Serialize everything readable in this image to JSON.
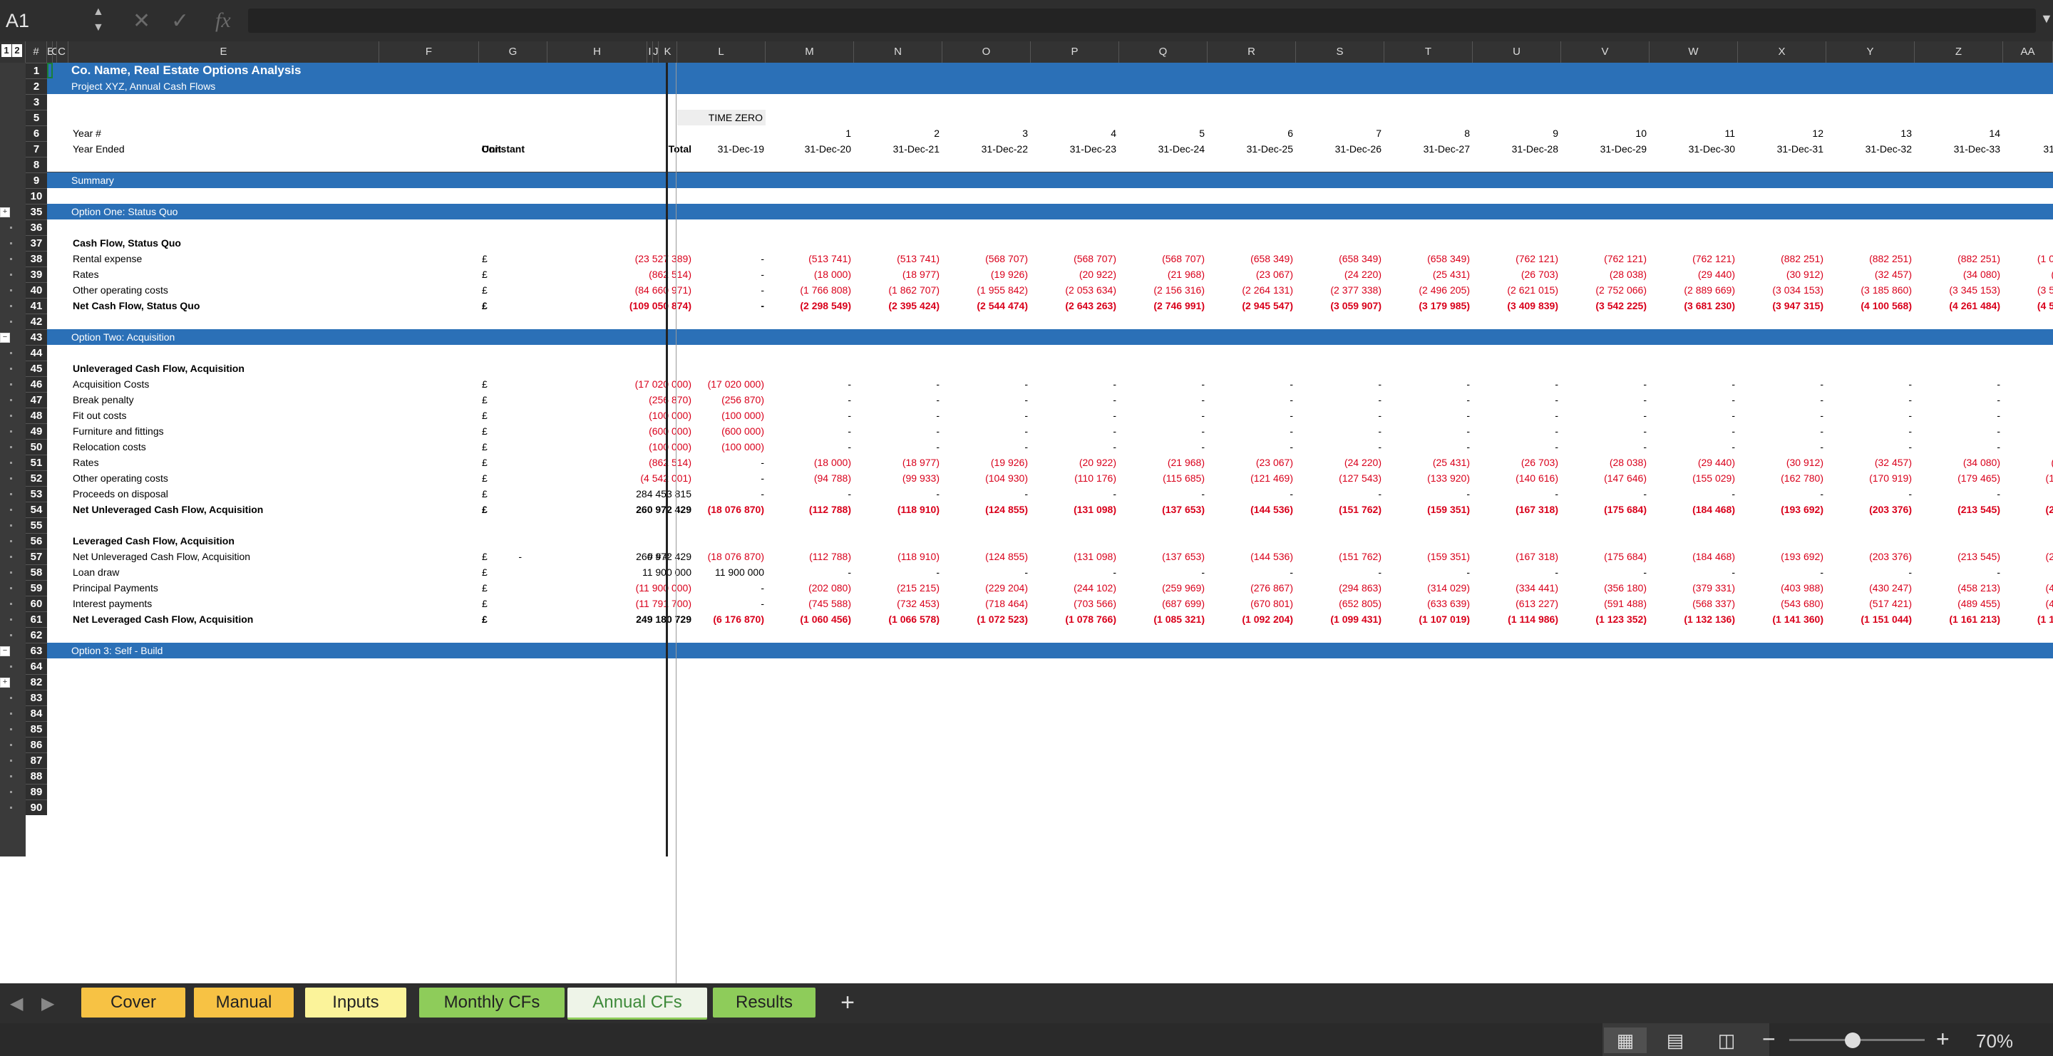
{
  "formula_bar": {
    "name_box": "A1",
    "fx_label": "fx",
    "formula": ""
  },
  "columns": [
    "",
    "#",
    "E",
    "C",
    "C",
    "E",
    "F",
    "G",
    "H",
    "I",
    "J",
    "K",
    "L",
    "M",
    "N",
    "O",
    "P",
    "Q",
    "R",
    "S",
    "T",
    "U",
    "V",
    "W",
    "X",
    "Y",
    "Z",
    "AA"
  ],
  "outline_levels": [
    "1",
    "2"
  ],
  "rows": [
    {
      "n": "1",
      "type": "band",
      "title": "Co. Name, Real Estate Options Analysis",
      "big": true
    },
    {
      "n": "2",
      "type": "band",
      "title": "Project XYZ, Annual Cash Flows"
    },
    {
      "n": "3",
      "type": "blank"
    },
    {
      "n": "5",
      "type": "timezero",
      "label": "TIME ZERO",
      "value": "-"
    },
    {
      "n": "6",
      "type": "header",
      "label": "Year #",
      "values": [
        "1",
        "2",
        "3",
        "4",
        "5",
        "6",
        "7",
        "8",
        "9",
        "10",
        "11",
        "12",
        "13",
        "14"
      ]
    },
    {
      "n": "7",
      "type": "header2",
      "label": "Year Ended",
      "constant": "Constant",
      "unit": "Unit",
      "total": "Total",
      "l": "31-Dec-19",
      "values": [
        "31-Dec-20",
        "31-Dec-21",
        "31-Dec-22",
        "31-Dec-23",
        "31-Dec-24",
        "31-Dec-25",
        "31-Dec-26",
        "31-Dec-27",
        "31-Dec-28",
        "31-Dec-29",
        "31-Dec-30",
        "31-Dec-31",
        "31-Dec-32",
        "31-Dec-33",
        "31"
      ]
    },
    {
      "n": "8",
      "type": "blank"
    },
    {
      "n": "9",
      "type": "band",
      "title": "Summary"
    },
    {
      "n": "10",
      "type": "blank"
    },
    {
      "n": "35",
      "type": "band",
      "title": "Option One: Status Quo"
    },
    {
      "n": "36",
      "type": "blank"
    },
    {
      "n": "37",
      "type": "section",
      "label": "Cash Flow, Status Quo"
    },
    {
      "n": "38",
      "type": "data",
      "label": "Rental expense",
      "unit": "£",
      "total": "(23 527 389)",
      "l": "-",
      "values": [
        "(513 741)",
        "(513 741)",
        "(568 707)",
        "(568 707)",
        "(568 707)",
        "(658 349)",
        "(658 349)",
        "(658 349)",
        "(762 121)",
        "(762 121)",
        "(762 121)",
        "(882 251)",
        "(882 251)",
        "(882 251)",
        "(1 0"
      ]
    },
    {
      "n": "39",
      "type": "data",
      "label": "Rates",
      "unit": "£",
      "total": "(862 514)",
      "l": "-",
      "values": [
        "(18 000)",
        "(18 977)",
        "(19 926)",
        "(20 922)",
        "(21 968)",
        "(23 067)",
        "(24 220)",
        "(25 431)",
        "(26 703)",
        "(28 038)",
        "(29 440)",
        "(30 912)",
        "(32 457)",
        "(34 080)",
        "("
      ]
    },
    {
      "n": "40",
      "type": "data",
      "label": "Other operating costs",
      "unit": "£",
      "total": "(84 660 971)",
      "l": "-",
      "values": [
        "(1 766 808)",
        "(1 862 707)",
        "(1 955 842)",
        "(2 053 634)",
        "(2 156 316)",
        "(2 264 131)",
        "(2 377 338)",
        "(2 496 205)",
        "(2 621 015)",
        "(2 752 066)",
        "(2 889 669)",
        "(3 034 153)",
        "(3 185 860)",
        "(3 345 153)",
        "(3 5"
      ]
    },
    {
      "n": "41",
      "type": "data",
      "bold": true,
      "label": "Net Cash Flow, Status Quo",
      "unit": "£",
      "total": "(109 050 874)",
      "l": "-",
      "values": [
        "(2 298 549)",
        "(2 395 424)",
        "(2 544 474)",
        "(2 643 263)",
        "(2 746 991)",
        "(2 945 547)",
        "(3 059 907)",
        "(3 179 985)",
        "(3 409 839)",
        "(3 542 225)",
        "(3 681 230)",
        "(3 947 315)",
        "(4 100 568)",
        "(4 261 484)",
        "(4 5"
      ]
    },
    {
      "n": "42",
      "type": "blank"
    },
    {
      "n": "43",
      "type": "band",
      "title": "Option Two: Acquisition"
    },
    {
      "n": "44",
      "type": "blank"
    },
    {
      "n": "45",
      "type": "section",
      "label": "Unleveraged Cash Flow, Acquisition"
    },
    {
      "n": "46",
      "type": "data",
      "label": "Acquisition Costs",
      "unit": "£",
      "total": "(17 020 000)",
      "l": "(17 020 000)",
      "values": [
        "-",
        "-",
        "-",
        "-",
        "-",
        "-",
        "-",
        "-",
        "-",
        "-",
        "-",
        "-",
        "-",
        "-",
        ""
      ]
    },
    {
      "n": "47",
      "type": "data",
      "label": "Break penalty",
      "unit": "£",
      "total": "(256 870)",
      "l": "(256 870)",
      "values": [
        "-",
        "-",
        "-",
        "-",
        "-",
        "-",
        "-",
        "-",
        "-",
        "-",
        "-",
        "-",
        "-",
        "-",
        ""
      ]
    },
    {
      "n": "48",
      "type": "data",
      "label": "Fit out costs",
      "unit": "£",
      "total": "(100 000)",
      "l": "(100 000)",
      "values": [
        "-",
        "-",
        "-",
        "-",
        "-",
        "-",
        "-",
        "-",
        "-",
        "-",
        "-",
        "-",
        "-",
        "-",
        ""
      ]
    },
    {
      "n": "49",
      "type": "data",
      "label": "Furniture and fittings",
      "unit": "£",
      "total": "(600 000)",
      "l": "(600 000)",
      "values": [
        "-",
        "-",
        "-",
        "-",
        "-",
        "-",
        "-",
        "-",
        "-",
        "-",
        "-",
        "-",
        "-",
        "-",
        ""
      ]
    },
    {
      "n": "50",
      "type": "data",
      "label": "Relocation costs",
      "unit": "£",
      "total": "(100 000)",
      "l": "(100 000)",
      "values": [
        "-",
        "-",
        "-",
        "-",
        "-",
        "-",
        "-",
        "-",
        "-",
        "-",
        "-",
        "-",
        "-",
        "-",
        ""
      ]
    },
    {
      "n": "51",
      "type": "data",
      "label": "Rates",
      "unit": "£",
      "total": "(862 514)",
      "l": "-",
      "values": [
        "(18 000)",
        "(18 977)",
        "(19 926)",
        "(20 922)",
        "(21 968)",
        "(23 067)",
        "(24 220)",
        "(25 431)",
        "(26 703)",
        "(28 038)",
        "(29 440)",
        "(30 912)",
        "(32 457)",
        "(34 080)",
        "("
      ]
    },
    {
      "n": "52",
      "type": "data",
      "label": "Other operating costs",
      "unit": "£",
      "total": "(4 542 001)",
      "l": "-",
      "values": [
        "(94 788)",
        "(99 933)",
        "(104 930)",
        "(110 176)",
        "(115 685)",
        "(121 469)",
        "(127 543)",
        "(133 920)",
        "(140 616)",
        "(147 646)",
        "(155 029)",
        "(162 780)",
        "(170 919)",
        "(179 465)",
        "(1"
      ]
    },
    {
      "n": "53",
      "type": "data",
      "label": "Proceeds on disposal",
      "unit": "£",
      "total": "284 453 815",
      "total_black": true,
      "l": "-",
      "values": [
        "-",
        "-",
        "-",
        "-",
        "-",
        "-",
        "-",
        "-",
        "-",
        "-",
        "-",
        "-",
        "-",
        "-",
        ""
      ]
    },
    {
      "n": "54",
      "type": "data",
      "bold": true,
      "label": "Net Unleveraged Cash Flow, Acquisition",
      "unit": "£",
      "total": "260 972 429",
      "total_black": true,
      "l": "(18 076 870)",
      "values": [
        "(112 788)",
        "(118 910)",
        "(124 855)",
        "(131 098)",
        "(137 653)",
        "(144 536)",
        "(151 762)",
        "(159 351)",
        "(167 318)",
        "(175 684)",
        "(184 468)",
        "(193 692)",
        "(203 376)",
        "(213 545)",
        "(2"
      ]
    },
    {
      "n": "55",
      "type": "blank"
    },
    {
      "n": "56",
      "type": "section",
      "label": "Leveraged Cash Flow, Acquisition"
    },
    {
      "n": "57",
      "type": "data",
      "label": "Net Unleveraged Cash Flow, Acquisition",
      "constant": "-",
      "unit": "£",
      "total": "260 972 429",
      "total_black": true,
      "ijk": "# # #",
      "l": "(18 076 870)",
      "values": [
        "(112 788)",
        "(118 910)",
        "(124 855)",
        "(131 098)",
        "(137 653)",
        "(144 536)",
        "(151 762)",
        "(159 351)",
        "(167 318)",
        "(175 684)",
        "(184 468)",
        "(193 692)",
        "(203 376)",
        "(213 545)",
        "(2"
      ]
    },
    {
      "n": "58",
      "type": "data",
      "label": "Loan draw",
      "unit": "£",
      "total": "11 900 000",
      "total_black": true,
      "l": "11 900 000",
      "l_black": true,
      "values": [
        "-",
        "-",
        "-",
        "-",
        "-",
        "-",
        "-",
        "-",
        "-",
        "-",
        "-",
        "-",
        "-",
        "-",
        ""
      ]
    },
    {
      "n": "59",
      "type": "data",
      "label": "Principal Payments",
      "unit": "£",
      "total": "(11 900 000)",
      "l": "-",
      "values": [
        "(202 080)",
        "(215 215)",
        "(229 204)",
        "(244 102)",
        "(259 969)",
        "(276 867)",
        "(294 863)",
        "(314 029)",
        "(334 441)",
        "(356 180)",
        "(379 331)",
        "(403 988)",
        "(430 247)",
        "(458 213)",
        "(4"
      ]
    },
    {
      "n": "60",
      "type": "data",
      "label": "Interest payments",
      "unit": "£",
      "total": "(11 791 700)",
      "l": "-",
      "values": [
        "(745 588)",
        "(732 453)",
        "(718 464)",
        "(703 566)",
        "(687 699)",
        "(670 801)",
        "(652 805)",
        "(633 639)",
        "(613 227)",
        "(591 488)",
        "(568 337)",
        "(543 680)",
        "(517 421)",
        "(489 455)",
        "(4"
      ]
    },
    {
      "n": "61",
      "type": "data",
      "bold": true,
      "label": "Net Leveraged Cash Flow, Acquisition",
      "unit": "£",
      "total": "249 180 729",
      "total_black": true,
      "l": "(6 176 870)",
      "values": [
        "(1 060 456)",
        "(1 066 578)",
        "(1 072 523)",
        "(1 078 766)",
        "(1 085 321)",
        "(1 092 204)",
        "(1 099 431)",
        "(1 107 019)",
        "(1 114 986)",
        "(1 123 352)",
        "(1 132 136)",
        "(1 141 360)",
        "(1 151 044)",
        "(1 161 213)",
        "(1 1"
      ]
    },
    {
      "n": "62",
      "type": "blank"
    },
    {
      "n": "63",
      "type": "band",
      "title": "Option 3: Self - Build"
    },
    {
      "n": "64",
      "type": "blank"
    },
    {
      "n": "82",
      "type": "blank"
    },
    {
      "n": "83",
      "type": "blank"
    },
    {
      "n": "84",
      "type": "blank"
    },
    {
      "n": "85",
      "type": "blank"
    },
    {
      "n": "86",
      "type": "blank"
    },
    {
      "n": "87",
      "type": "blank"
    },
    {
      "n": "88",
      "type": "blank"
    },
    {
      "n": "89",
      "type": "blank"
    },
    {
      "n": "90",
      "type": "blank"
    }
  ],
  "tabs": [
    {
      "label": "Cover",
      "color": "#f7c244"
    },
    {
      "label": "Manual",
      "color": "#f7c244"
    },
    {
      "label": "Inputs",
      "color": "#fbf39a"
    },
    {
      "label": "Monthly CFs",
      "color": "#8ecc5a"
    },
    {
      "label": "Annual CFs",
      "color": "#eef4e8",
      "active": true
    },
    {
      "label": "Results",
      "color": "#8ecc5a"
    }
  ],
  "add_sheet": "+",
  "zoom": {
    "label": "70%",
    "level": 0.47
  }
}
